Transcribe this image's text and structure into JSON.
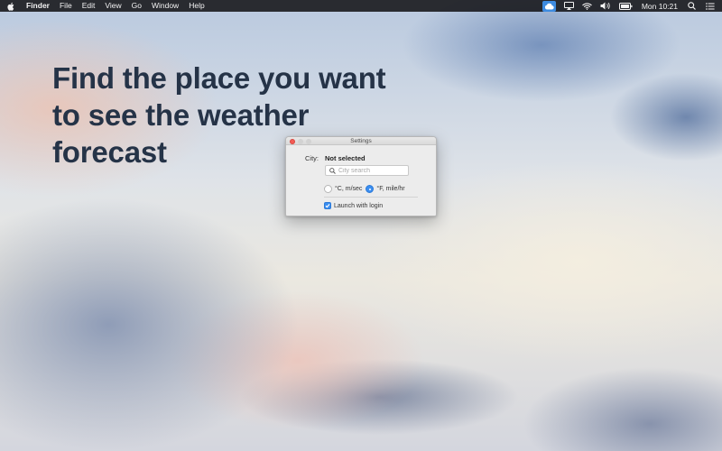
{
  "menubar": {
    "apple": "apple-icon",
    "items": [
      "Finder",
      "File",
      "Edit",
      "View",
      "Go",
      "Window",
      "Help"
    ],
    "status_icons": [
      "weather-cloud-icon",
      "airplay-icon",
      "wifi-icon",
      "volume-icon",
      "battery-icon"
    ],
    "clock": "Mon 10:21",
    "right_icons": [
      "spotlight-search-icon",
      "notification-center-icon"
    ]
  },
  "hero": {
    "headline": "Find the place you want\nto see the weather\nforecast"
  },
  "settings_window": {
    "title": "Settings",
    "city_label": "City:",
    "city_value": "Not selected",
    "search_placeholder": "City search",
    "units": [
      {
        "label": "°C, m/sec",
        "selected": false
      },
      {
        "label": "°F, mile/hr",
        "selected": true
      }
    ],
    "launch_with_login": {
      "label": "Launch with login",
      "checked": true
    }
  },
  "colors": {
    "accent": "#3b8ef0",
    "headline": "#253347",
    "close_button": "#f45c55"
  }
}
